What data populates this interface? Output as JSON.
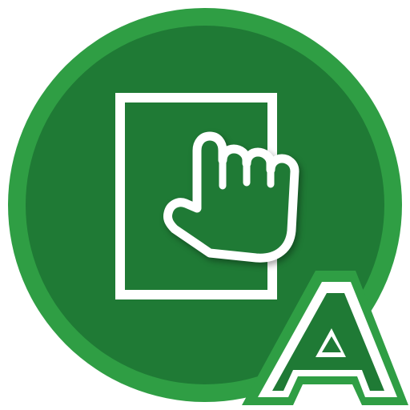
{
  "app_icon": {
    "name": "tap-page-app-icon",
    "badge_letter": "A",
    "colors": {
      "outer_ring": "#2f9e44",
      "inner_disc": "#1f7a35",
      "foreground": "#ffffff",
      "badge_fill": "#1f7a35",
      "badge_outline": "#2f9e44"
    },
    "icons": {
      "page": "tablet-page-icon",
      "hand": "pointing-hand-icon",
      "badge": "letter-a-badge"
    }
  }
}
